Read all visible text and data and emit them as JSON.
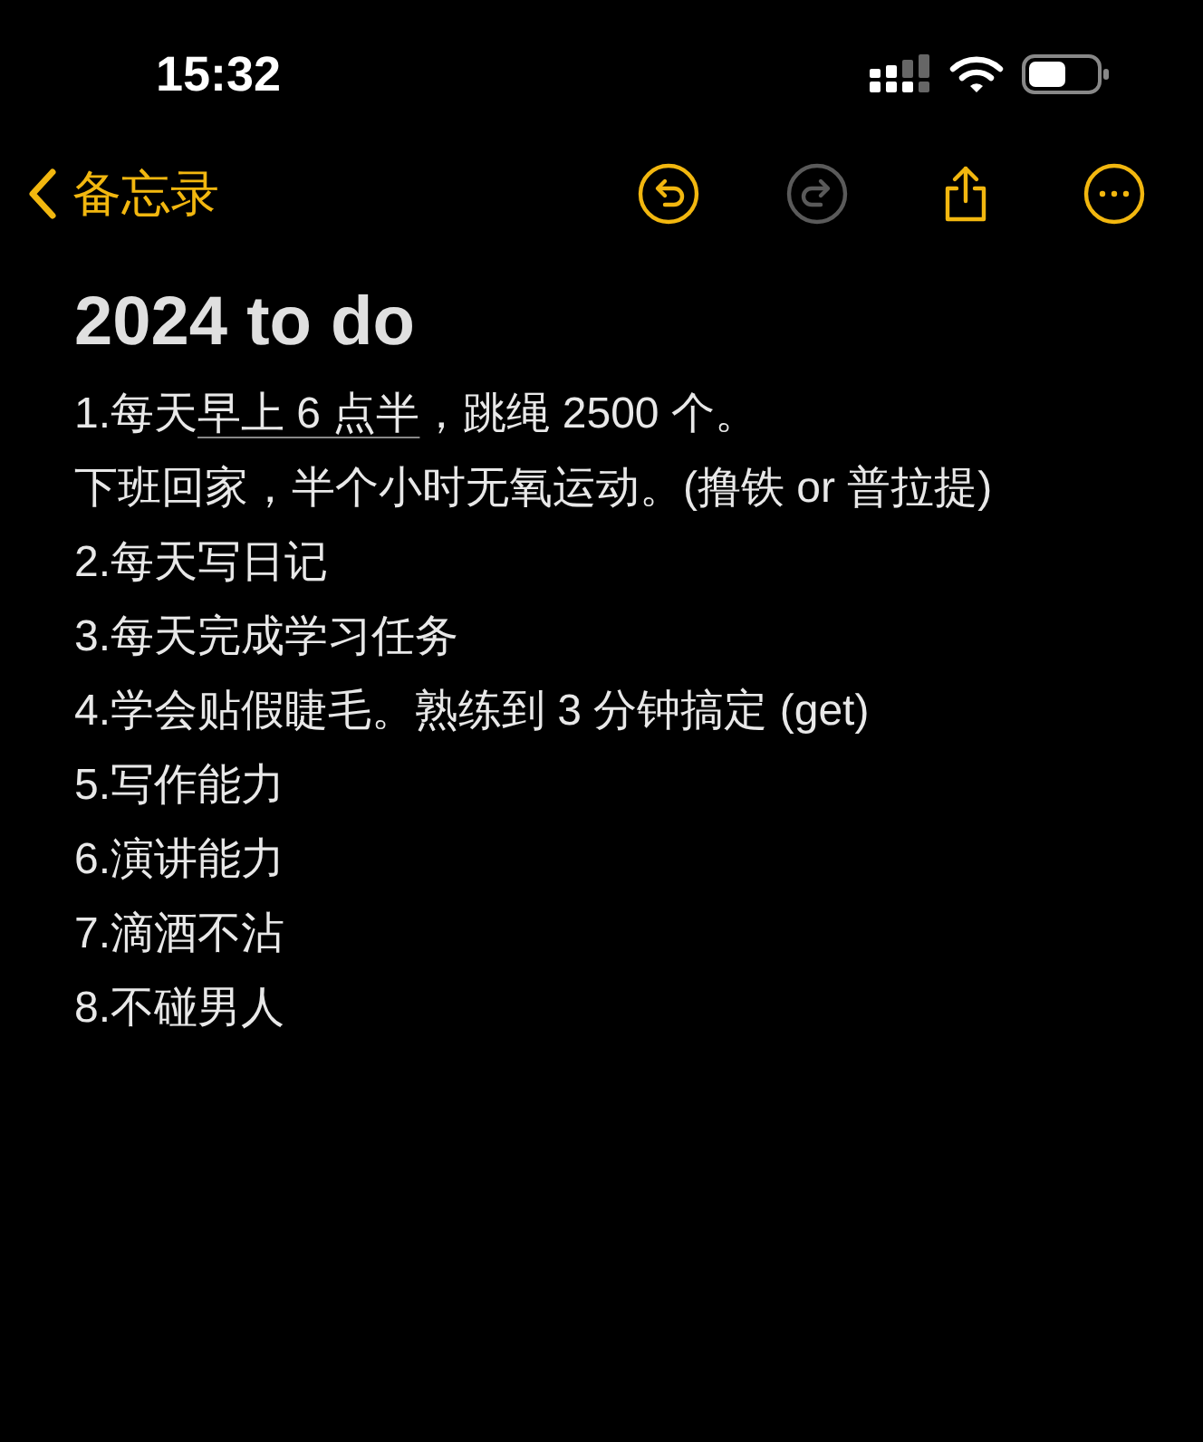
{
  "status_bar": {
    "time": "15:32"
  },
  "nav": {
    "back_label": "备忘录",
    "tools": [
      {
        "kind": "undo",
        "disabled": false
      },
      {
        "kind": "redo",
        "disabled": true
      },
      {
        "kind": "share",
        "disabled": false
      },
      {
        "kind": "more",
        "disabled": false
      }
    ]
  },
  "note": {
    "title": "2024 to do",
    "lines": [
      {
        "parts": [
          {
            "text": "1.每天",
            "link": false
          },
          {
            "text": "早上 6 点半",
            "link": true
          },
          {
            "text": "，跳绳 2500 个。",
            "link": false
          }
        ]
      },
      {
        "parts": [
          {
            "text": "下班回家，半个小时无氧运动。(撸铁 or 普拉提)",
            "link": false
          }
        ]
      },
      {
        "parts": [
          {
            "text": "2.每天写日记",
            "link": false
          }
        ]
      },
      {
        "parts": [
          {
            "text": "3.每天完成学习任务",
            "link": false
          }
        ]
      },
      {
        "parts": [
          {
            "text": "4.学会贴假睫毛。熟练到 3 分钟搞定 (get)",
            "link": false
          }
        ]
      },
      {
        "parts": [
          {
            "text": "5.写作能力",
            "link": false
          }
        ]
      },
      {
        "parts": [
          {
            "text": "6.演讲能力",
            "link": false
          }
        ]
      },
      {
        "parts": [
          {
            "text": "7.滴酒不沾",
            "link": false
          }
        ]
      },
      {
        "parts": [
          {
            "text": "8.不碰男人",
            "link": false
          }
        ]
      }
    ]
  }
}
